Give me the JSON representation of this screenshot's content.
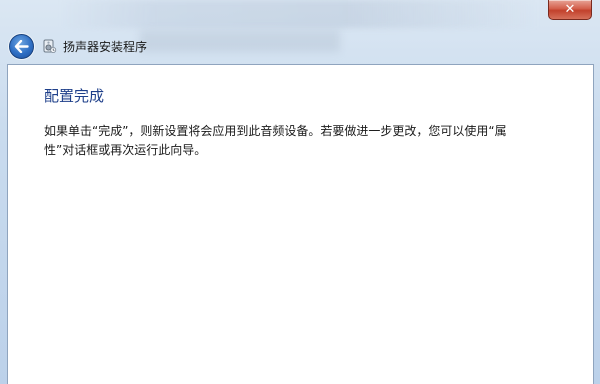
{
  "window": {
    "close_label": "✕"
  },
  "nav": {
    "title": "扬声器安装程序"
  },
  "page": {
    "heading": "配置完成",
    "body": "如果单击“完成”，则新设置将会应用到此音频设备。若要做进一步更改，您可以使用“属性”对话框或再次运行此向导。"
  },
  "colors": {
    "heading": "#1e3f8a",
    "close_button": "#c2412c",
    "back_button": "#2f6fc4"
  },
  "icons": {
    "back": "back-arrow-icon",
    "app": "speaker-setup-icon",
    "close": "close-icon"
  }
}
